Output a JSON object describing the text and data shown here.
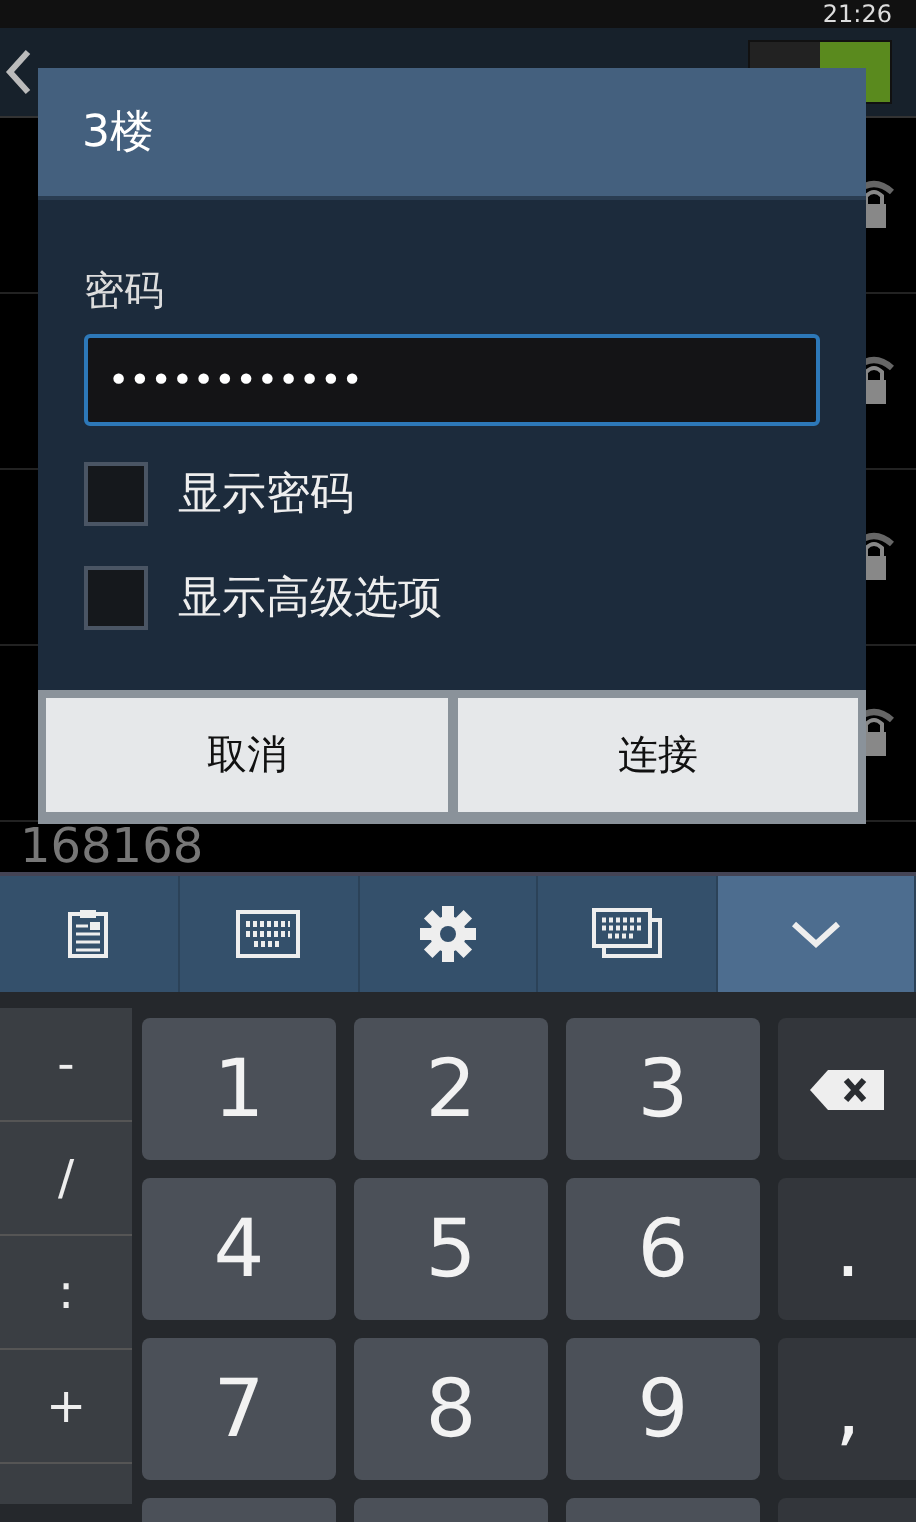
{
  "status_bar": {
    "time": "21:26"
  },
  "background": {
    "footer_text": "168168",
    "wifi_on": true
  },
  "dialog": {
    "title": "3楼",
    "password_label": "密码",
    "password_value": "••••••••••••",
    "options": [
      {
        "label": "显示密码",
        "checked": false
      },
      {
        "label": "显示高级选项",
        "checked": false
      }
    ],
    "buttons": [
      "取消",
      "连接"
    ]
  },
  "keyboard": {
    "toolbar": [
      {
        "kind": "clipboard"
      },
      {
        "kind": "keyboard"
      },
      {
        "kind": "settings"
      },
      {
        "kind": "multi-keyboard"
      },
      {
        "kind": "hide"
      }
    ],
    "symbols": [
      "-",
      "/",
      ":",
      "+"
    ],
    "keys": [
      {
        "kind": "char",
        "label": "1"
      },
      {
        "kind": "char",
        "label": "2"
      },
      {
        "kind": "char",
        "label": "3"
      },
      {
        "kind": "backspace"
      },
      {
        "kind": "char",
        "label": "4"
      },
      {
        "kind": "char",
        "label": "5"
      },
      {
        "kind": "char",
        "label": "6"
      },
      {
        "kind": "char",
        "label": "."
      },
      {
        "kind": "char",
        "label": "7"
      },
      {
        "kind": "char",
        "label": "8"
      },
      {
        "kind": "char",
        "label": "9"
      },
      {
        "kind": "char",
        "label": ","
      }
    ]
  }
}
